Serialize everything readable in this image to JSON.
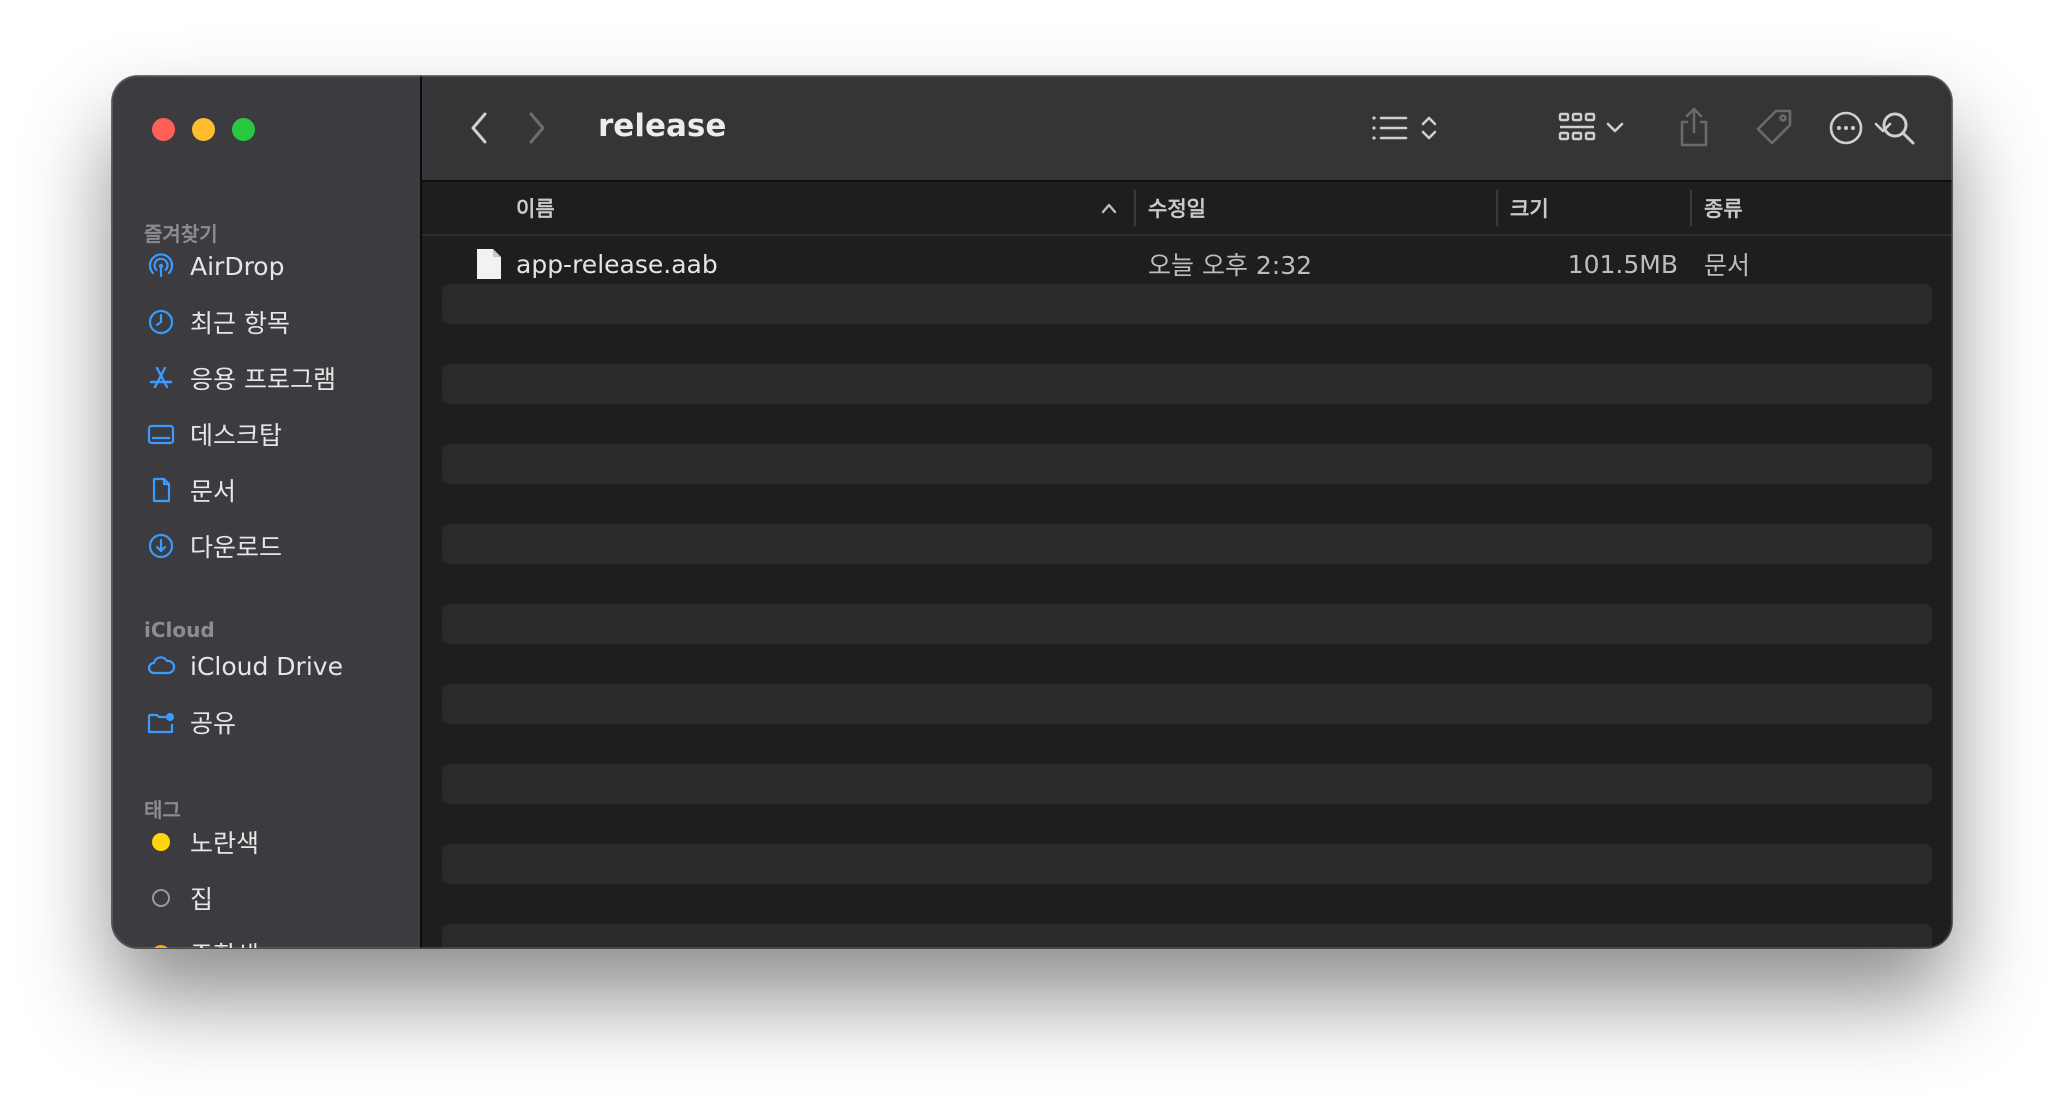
{
  "window": {
    "title": "release"
  },
  "sidebar": {
    "favorites_label": "즐겨찾기",
    "favorites": [
      {
        "label": "AirDrop",
        "icon": "airdrop-icon"
      },
      {
        "label": "최근 항목",
        "icon": "clock-icon"
      },
      {
        "label": "응용 프로그램",
        "icon": "applications-icon"
      },
      {
        "label": "데스크탑",
        "icon": "desktop-icon"
      },
      {
        "label": "문서",
        "icon": "document-icon"
      },
      {
        "label": "다운로드",
        "icon": "download-icon"
      }
    ],
    "icloud_label": "iCloud",
    "icloud": [
      {
        "label": "iCloud Drive",
        "icon": "cloud-icon"
      },
      {
        "label": "공유",
        "icon": "shared-folder-icon"
      }
    ],
    "tags_label": "태그",
    "tags": [
      {
        "label": "노란색",
        "color": "#ffd60a"
      },
      {
        "label": "집",
        "color": ""
      },
      {
        "label": "주황색",
        "color": "#ff9f0a"
      }
    ]
  },
  "columns": {
    "name": "이름",
    "modified": "수정일",
    "size": "크기",
    "kind": "종류"
  },
  "files": [
    {
      "name": "app-release.aab",
      "modified": "오늘 오후 2:32",
      "size": "101.5MB",
      "kind": "문서"
    }
  ],
  "colors": {
    "accent": "#3b9cff",
    "sidebar_bg": "#3c3b3f",
    "content_bg": "#1e1e1e",
    "stripe": "#2a2a2a"
  }
}
